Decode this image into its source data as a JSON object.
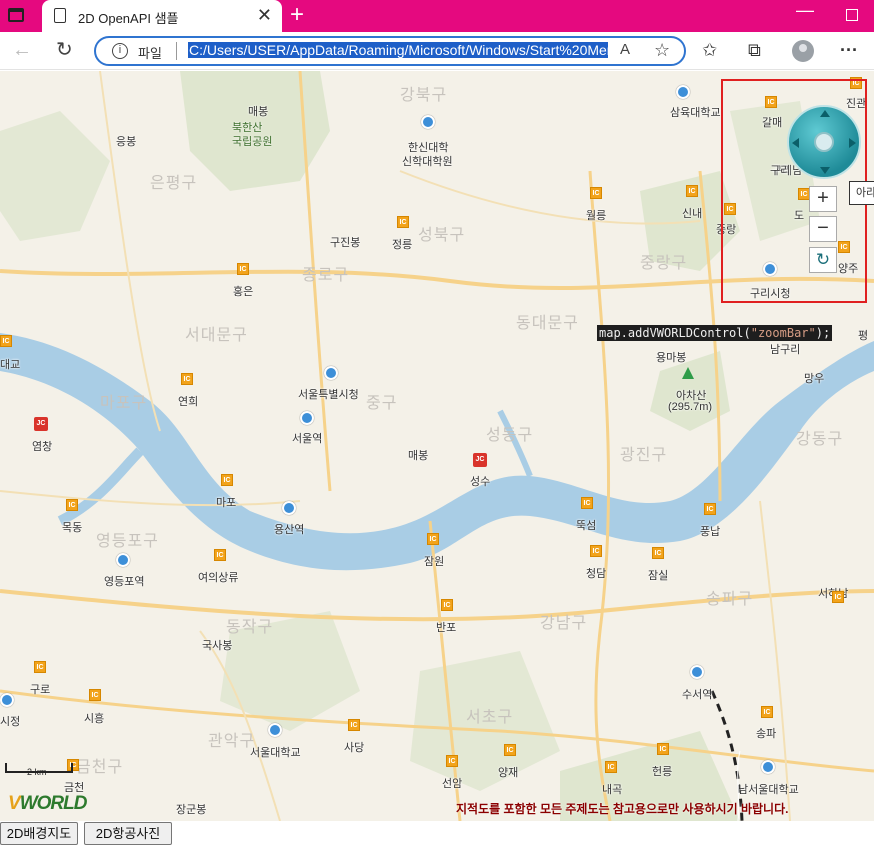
{
  "browser": {
    "tab_title": "2D OpenAPI 샘플",
    "tab_close": "✕",
    "new_tab": "+",
    "file_label": "파일",
    "url": "C:/Users/USER/AppData/Roaming/Microsoft/Windows/Start%20Menu",
    "read_aloud": "A",
    "add_favorite": "☆"
  },
  "map": {
    "code_overlay_prefix": "map.addVWORLDControl(",
    "code_overlay_string": "\"zoomBar\"",
    "code_overlay_suffix": ");",
    "code_overlay_trail": "평",
    "controls": {
      "zoom_in": "+",
      "zoom_out": "−",
      "reset": "↻",
      "tooltip": "아라"
    },
    "scale_label": "2 km",
    "logo": {
      "v": "V",
      "rest": "WORLD"
    },
    "disclaimer": "지적도를 포함한 모든 주제도는 참고용으로만 사용하시기 바랍니다.",
    "districts": [
      "강북구",
      "은평구",
      "성북구",
      "종로구",
      "서대문구",
      "동대문구",
      "중랑구",
      "마포구",
      "중구",
      "성동구",
      "광진구",
      "강동구",
      "영등포구",
      "동작구",
      "강남구",
      "송파구",
      "관악구",
      "서초구",
      "금천구"
    ],
    "places": [
      "매봉",
      "북한산",
      "국립공원",
      "응봉",
      "한신대학",
      "신학대학원",
      "삼육대학교",
      "갈매",
      "구리남",
      "구진봉",
      "정릉",
      "월릉",
      "신내",
      "중랑",
      "홍은",
      "구리시청",
      "남구리",
      "용마봉",
      "아차산",
      "(295.7m)",
      "대교",
      "서울특별시청",
      "서울역",
      "연희",
      "염창",
      "매봉",
      "성수",
      "뚝섬",
      "풍납",
      "마포",
      "용산역",
      "목동",
      "영등포역",
      "여의상류",
      "잠원",
      "청담",
      "잠실",
      "반포",
      "국사봉",
      "구로",
      "시흥",
      "수서역",
      "서울대학교",
      "사당",
      "송파",
      "남서울대학교",
      "선암",
      "양재",
      "내곡",
      "헌릉",
      "장군봉",
      "금천",
      "시정",
      "서하남",
      "진관",
      "망우",
      "구리",
      "도",
      "양주"
    ]
  },
  "buttons": {
    "base_map": "2D배경지도",
    "aerial": "2D항공사진"
  },
  "colors": {
    "title_bar": "#e5097f",
    "river": "#a9cde5",
    "highlight": "#e02020",
    "disclaimer": "#8b0000"
  }
}
